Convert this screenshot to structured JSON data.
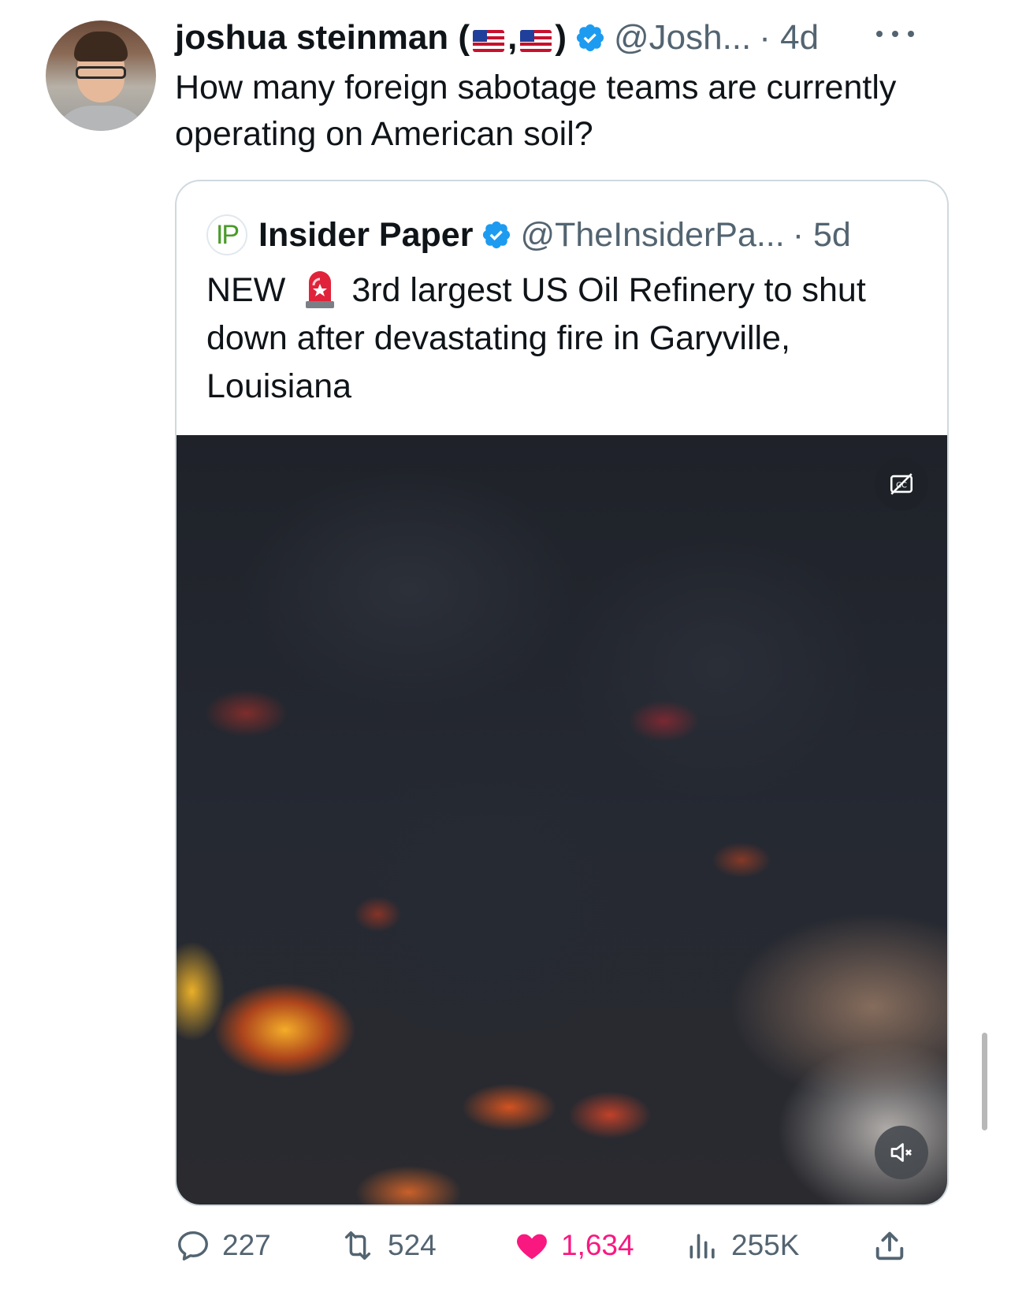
{
  "tweet": {
    "author_name": "joshua steinman",
    "name_open": " (",
    "name_sep": ",",
    "name_close": ")",
    "handle": "@Josh...",
    "time": "· 4d",
    "text": "How many foreign sabotage teams are currently operating on American soil?"
  },
  "quoted": {
    "logo_text": "IP",
    "author_name": "Insider Paper",
    "handle": "@TheInsiderPa...",
    "time": "· 5d",
    "text_prefix": "NEW",
    "text_body": "3rd largest US Oil Refinery to shut down after devastating fire in Garyville, Louisiana"
  },
  "actions": {
    "replies": "227",
    "reposts": "524",
    "likes": "1,634",
    "views": "255K"
  },
  "colors": {
    "verified": "#1d9bf0",
    "like": "#f91880",
    "muted": "#536471",
    "border": "#cfd9de"
  },
  "icons": [
    "verified-badge-icon",
    "more-icon",
    "siren-emoji",
    "closed-captions-icon",
    "mute-icon",
    "reply-icon",
    "repost-icon",
    "heart-icon",
    "views-icon",
    "share-icon"
  ]
}
